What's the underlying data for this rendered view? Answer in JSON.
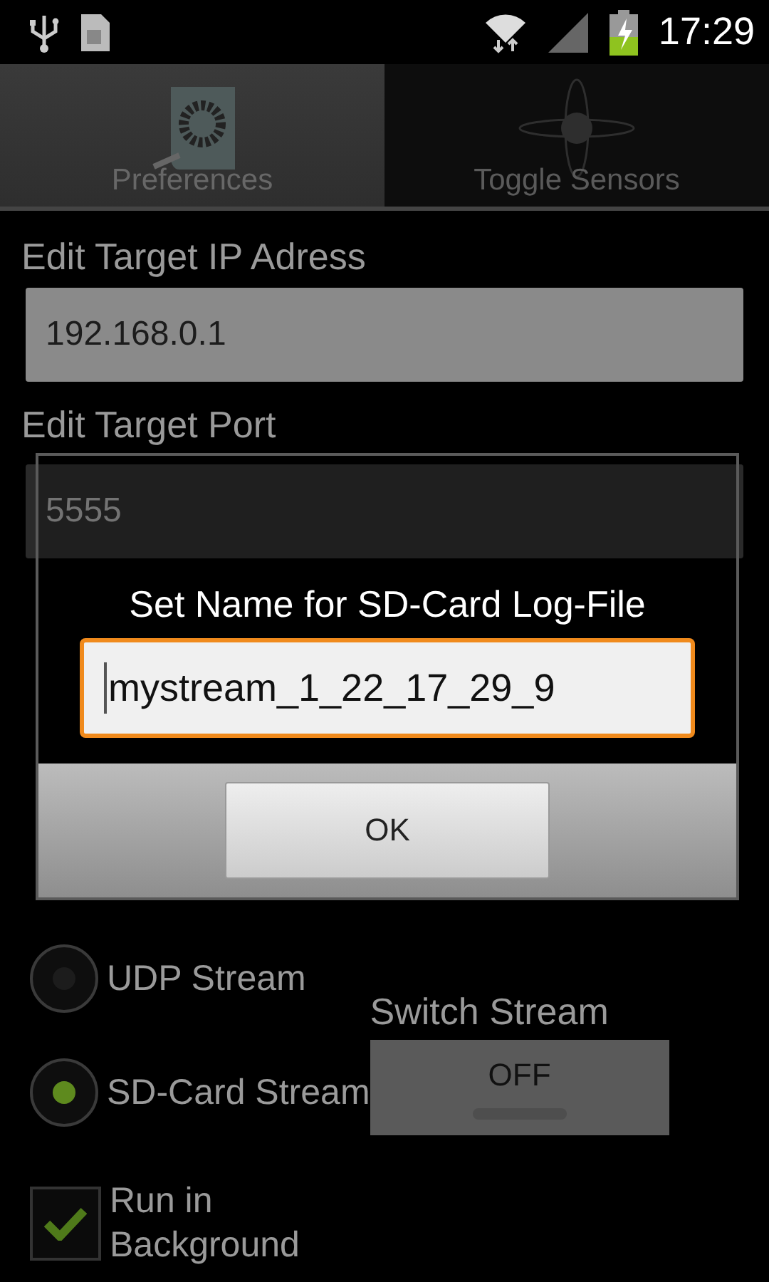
{
  "status_bar": {
    "time": "17:29"
  },
  "tabs": [
    {
      "label": "Preferences",
      "selected": true
    },
    {
      "label": "Toggle Sensors",
      "selected": false
    }
  ],
  "fields": [
    {
      "label": "Edit Target IP Adress",
      "value": "192.168.0.1"
    },
    {
      "label": "Edit Target Port",
      "value": "5555"
    }
  ],
  "stream_options": [
    {
      "label": "UDP Stream",
      "selected": false
    },
    {
      "label": "SD-Card Stream",
      "selected": true
    }
  ],
  "switch_stream": {
    "label": "Switch Stream",
    "on": false,
    "text": "OFF"
  },
  "run_in_background": {
    "label": "Run in Background",
    "checked": true
  },
  "dialog": {
    "title": "Set Name for SD-Card Log-File",
    "value": "mystream_1_22_17_29_9",
    "buttons": [
      "OK"
    ]
  }
}
